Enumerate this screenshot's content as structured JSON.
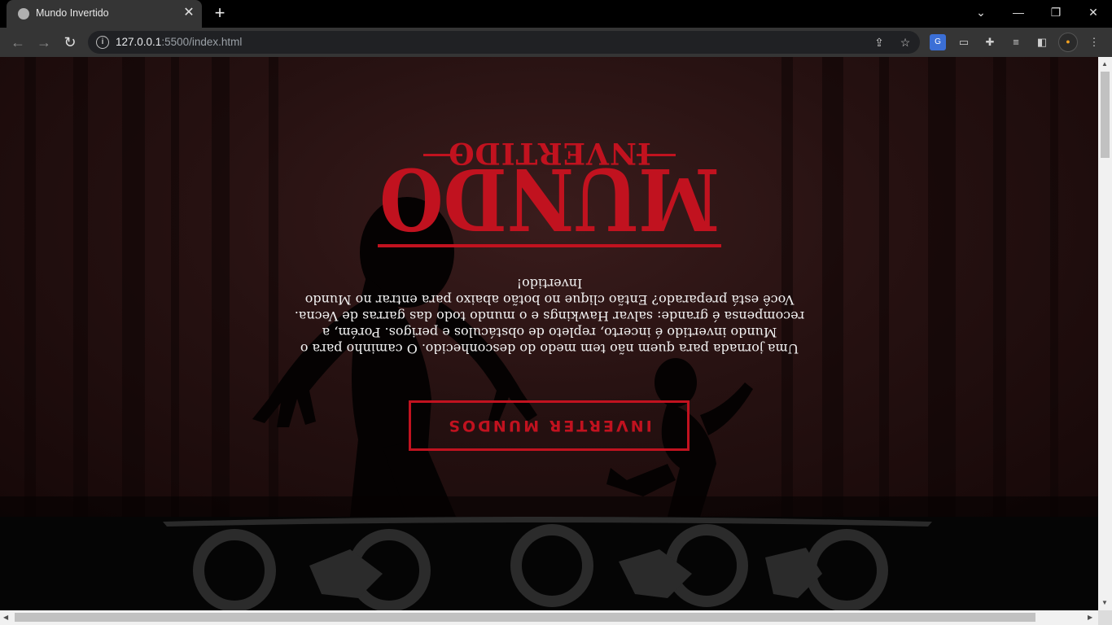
{
  "browser": {
    "tab_title": "Mundo Invertido",
    "url_host": "127.0.0.1",
    "url_rest": ":5500/index.html"
  },
  "page": {
    "logo_top": "INVERTIDO",
    "logo_main": "MUNDO",
    "description": "Uma jornada para quem não tem medo do desconhecido. O caminho para o Mundo invertido é incerto, repleto de obstáculos e perigos. Porém, a recompensa é grande: salvar Hawkings e o mundo todo das garras de Vecna. Você está preparado? Então clique no botão abaixo para entrar no Mundo Invertido!",
    "cta_label": "INVERTER MUNDOS"
  },
  "colors": {
    "accent": "#c1121f",
    "text": "#f2f2f2",
    "background": "#1e0e0e"
  },
  "icons": {
    "back": "arrow-left-icon",
    "forward": "arrow-right-icon",
    "reload": "reload-icon",
    "site_info": "info-icon",
    "share": "share-icon",
    "bookmark": "star-icon",
    "translate": "translate-icon",
    "cast": "cast-icon",
    "extensions": "puzzle-icon",
    "media": "media-control-icon",
    "sidepanel": "side-panel-icon",
    "profile": "avatar-icon",
    "menu": "kebab-menu-icon"
  }
}
